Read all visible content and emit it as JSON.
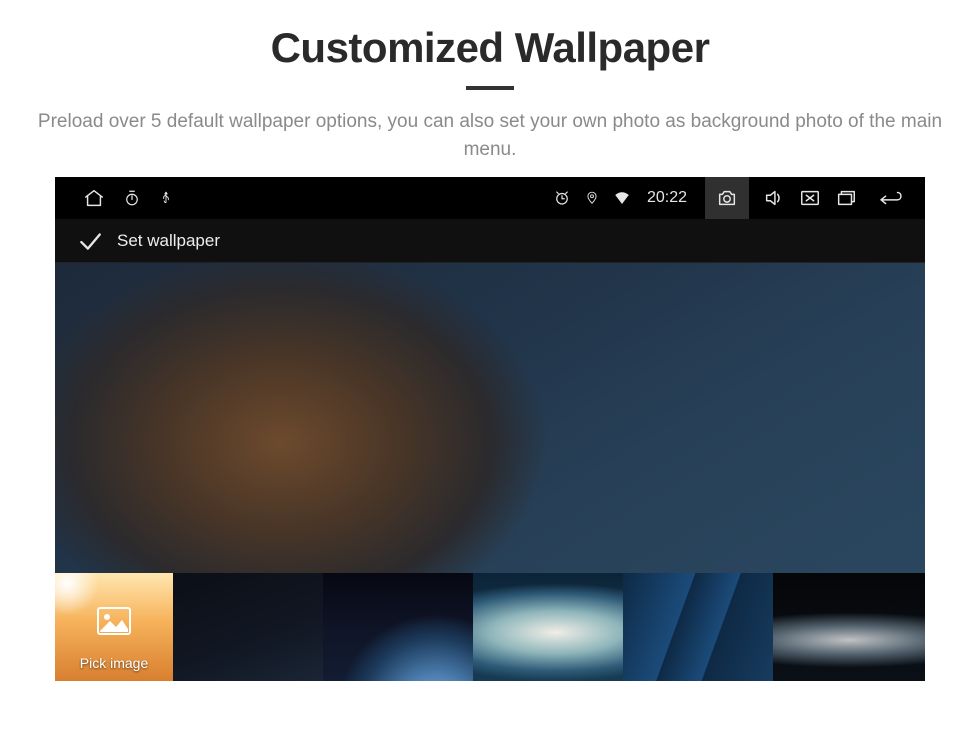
{
  "header": {
    "title": "Customized Wallpaper",
    "subtitle": "Preload over 5 default wallpaper options, you can also set your own photo as background photo of the main menu."
  },
  "statusbar": {
    "time": "20:22"
  },
  "subbar": {
    "label": "Set wallpaper"
  },
  "gallery": {
    "pick_label": "Pick image"
  }
}
